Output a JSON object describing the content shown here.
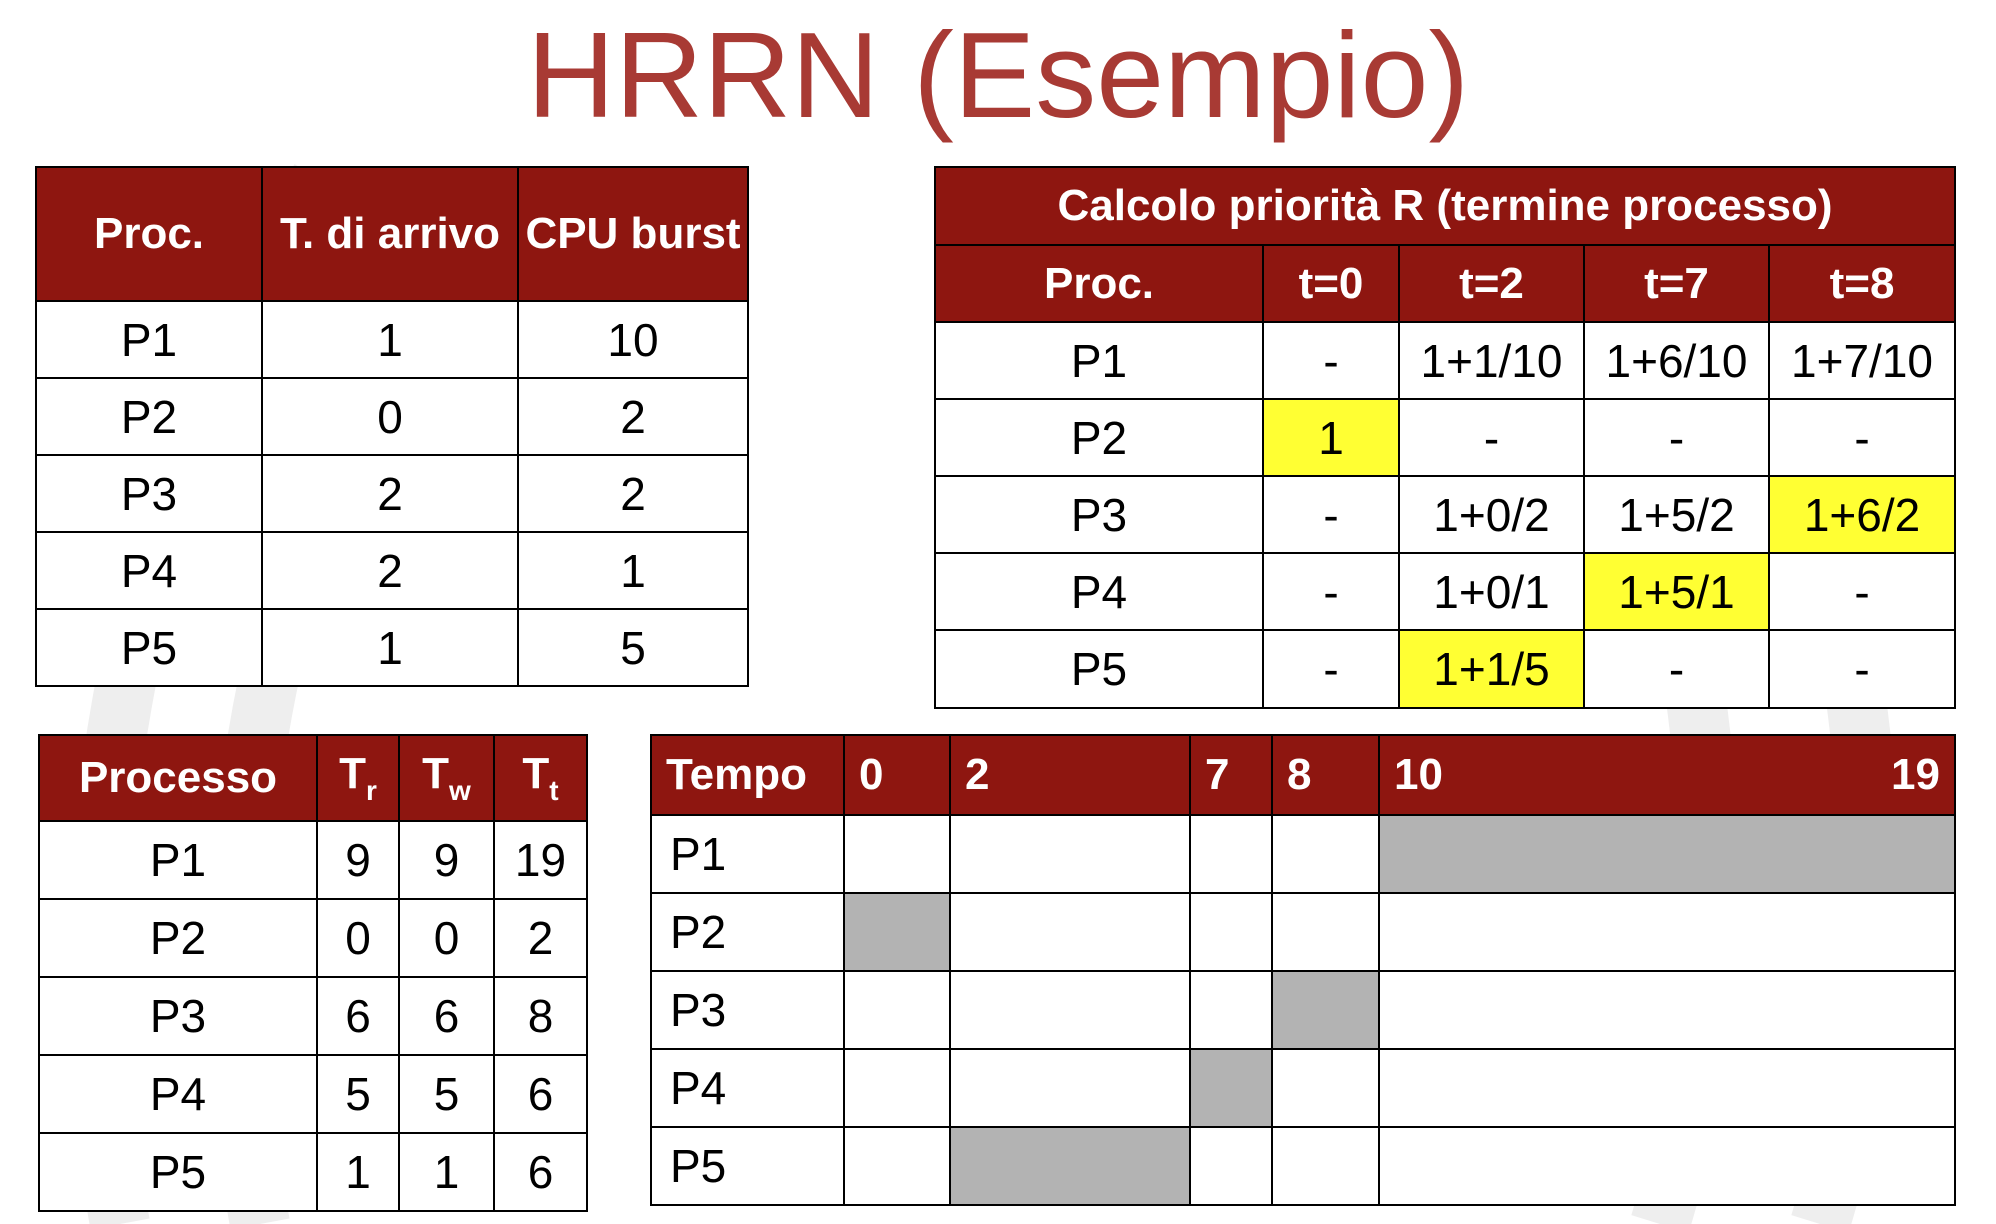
{
  "title": "HRRN (Esempio)",
  "colors": {
    "title": "#A83A34",
    "header": "#8E1610",
    "highlight": "#FFFF33",
    "bar": "#B3B3B3"
  },
  "processes": {
    "headers": [
      "Proc.",
      "T. di arrivo",
      "CPU burst"
    ],
    "rows": [
      [
        "P1",
        "1",
        "10"
      ],
      [
        "P2",
        "0",
        "2"
      ],
      [
        "P3",
        "2",
        "2"
      ],
      [
        "P4",
        "2",
        "1"
      ],
      [
        "P5",
        "1",
        "5"
      ]
    ]
  },
  "priority": {
    "title": "Calcolo priorità R (termine processo)",
    "headers": [
      "Proc.",
      "t=0",
      "t=2",
      "t=7",
      "t=8"
    ],
    "rows": [
      [
        "P1",
        "-",
        "1+1/10",
        "1+6/10",
        "1+7/10"
      ],
      [
        "P2",
        "1",
        "-",
        "-",
        "-"
      ],
      [
        "P3",
        "-",
        "1+0/2",
        "1+5/2",
        "1+6/2"
      ],
      [
        "P4",
        "-",
        "1+0/1",
        "1+5/1",
        "-"
      ],
      [
        "P5",
        "-",
        "1+1/5",
        "-",
        "-"
      ]
    ],
    "highlighted": [
      [
        1,
        1
      ],
      [
        2,
        4
      ],
      [
        3,
        3
      ],
      [
        4,
        2
      ]
    ]
  },
  "times": {
    "headers": {
      "process": "Processo",
      "tr": "T",
      "tr_sub": "r",
      "tw": "T",
      "tw_sub": "w",
      "tt": "T",
      "tt_sub": "t"
    },
    "rows": [
      [
        "P1",
        "9",
        "9",
        "19"
      ],
      [
        "P2",
        "0",
        "0",
        "2"
      ],
      [
        "P3",
        "6",
        "6",
        "8"
      ],
      [
        "P4",
        "5",
        "5",
        "6"
      ],
      [
        "P5",
        "1",
        "1",
        "6"
      ]
    ]
  },
  "gantt": {
    "label": "Tempo",
    "ticks": [
      "0",
      "2",
      "7",
      "8",
      "10",
      "19"
    ],
    "rows": [
      "P1",
      "P2",
      "P3",
      "P4",
      "P5"
    ],
    "schedule": [
      {
        "process": "P2",
        "start": 0,
        "end": 2
      },
      {
        "process": "P5",
        "start": 2,
        "end": 7
      },
      {
        "process": "P4",
        "start": 7,
        "end": 8
      },
      {
        "process": "P3",
        "start": 8,
        "end": 10
      },
      {
        "process": "P1",
        "start": 10,
        "end": 19
      }
    ]
  }
}
